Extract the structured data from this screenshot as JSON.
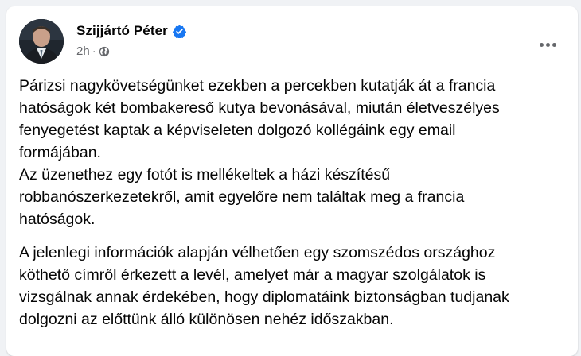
{
  "post": {
    "author_name": "Szijjártó Péter",
    "timestamp": "2h",
    "separator": "·",
    "verified": true,
    "audience_icon": "globe-icon",
    "more_icon": "more-options-icon",
    "colors": {
      "verified_blue": "#1877f2",
      "secondary_text": "#65676b",
      "primary_text": "#050505"
    },
    "paragraphs": [
      "Párizsi nagykövetségünket ezekben a percekben kutatják át a francia\nhatóságok két bombakereső kutya bevonásával, miután életveszélyes\nfenyegetést kaptak a képviseleten dolgozó kollégáink egy email\nformájában.\nAz üzenethez egy fotót is mellékeltek a házi készítésű\nrobbanószerkezetekről, amit egyelőre nem találtak meg a francia\nhatóságok.",
      "A jelenlegi információk alapján vélhetően egy szomszédos országhoz\nköthető címről érkezett a levél, amelyet már a magyar szolgálatok is\nvizsgálnak annak érdekében, hogy diplomatáink biztonságban tudjanak\ndolgozni az előttünk álló különösen nehéz időszakban."
    ]
  }
}
